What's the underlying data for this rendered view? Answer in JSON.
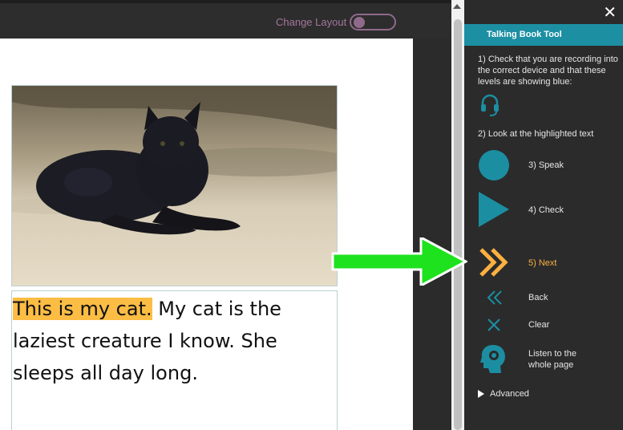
{
  "topbar": {
    "change_layout_label": "Change Layout",
    "change_layout_on": false
  },
  "page": {
    "highlighted_sentence": "This is my cat.",
    "rest_text": " My cat is the laziest creature I know. She sleeps all day long."
  },
  "panel": {
    "close_label": "✕",
    "title": "Talking Book Tool",
    "step1_text": "1) Check that you are recording into the correct device and that these levels are showing blue:",
    "step2_text": "2) Look at the highlighted text",
    "speak_label": "3) Speak",
    "check_label": "4) Check",
    "next_label": "5) Next",
    "back_label": "Back",
    "clear_label": "Clear",
    "listen_label_line1": "Listen to the",
    "listen_label_line2": "whole page",
    "advanced_label": "Advanced"
  },
  "colors": {
    "accent_teal": "#1b8ea2",
    "highlight": "#fcbd44",
    "next_orange": "#fbb040",
    "callout_green": "#1ee21e",
    "toggle_purple": "#8f6a8b"
  },
  "icons": {
    "headset": "headset-icon",
    "speak": "record-circle-icon",
    "check": "play-triangle-icon",
    "next": "double-chevron-right-icon",
    "back": "double-chevron-left-icon",
    "clear": "x-icon",
    "listen": "head-speaker-icon",
    "advanced": "caret-right-icon"
  }
}
